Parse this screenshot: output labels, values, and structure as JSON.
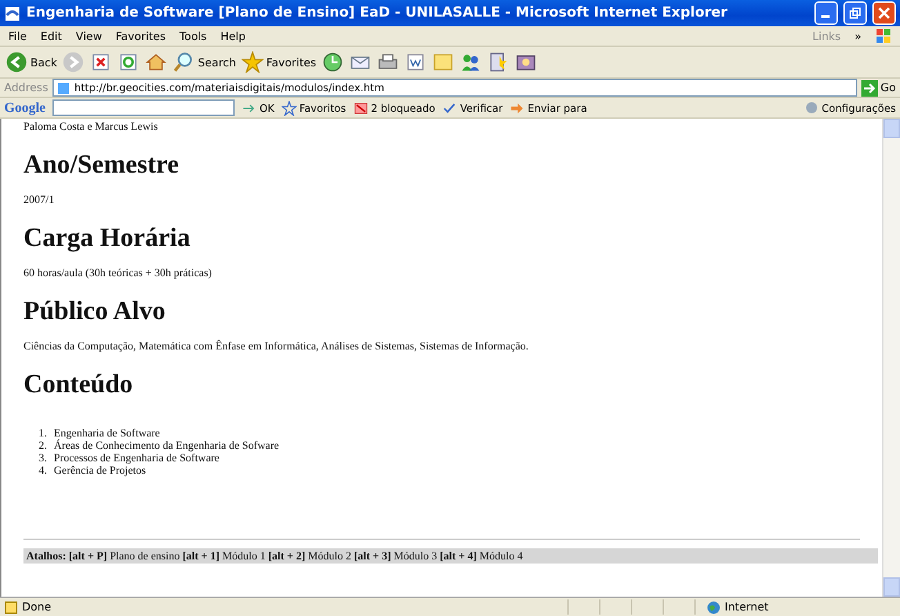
{
  "window": {
    "title": "Engenharia de Software [Plano de Ensino] EaD - UNILASALLE - Microsoft Internet Explorer"
  },
  "menu": [
    "File",
    "Edit",
    "View",
    "Favorites",
    "Tools",
    "Help"
  ],
  "links_label": "Links",
  "links_chevron": "»",
  "toolbar": [
    {
      "kind": "back",
      "label": "Back"
    },
    {
      "kind": "forward"
    },
    {
      "kind": "stop"
    },
    {
      "kind": "refresh"
    },
    {
      "kind": "home"
    },
    {
      "kind": "search",
      "label": "Search"
    },
    {
      "kind": "favorites",
      "label": "Favorites"
    },
    {
      "kind": "history"
    },
    {
      "kind": "mail"
    },
    {
      "kind": "print"
    },
    {
      "kind": "word"
    },
    {
      "kind": "note"
    },
    {
      "kind": "messenger"
    },
    {
      "kind": "research"
    },
    {
      "kind": "people"
    }
  ],
  "address": {
    "label": "Address",
    "value": "http://br.geocities.com/materiaisdigitais/modulos/index.htm",
    "go": "Go"
  },
  "google_bar": {
    "logo": "Google",
    "items": [
      {
        "kind": "ok",
        "label": "OK"
      },
      {
        "kind": "favorites",
        "label": "Favoritos"
      },
      {
        "kind": "blocked",
        "label": "2 bloqueado"
      },
      {
        "kind": "check",
        "label": "Verificar"
      },
      {
        "kind": "send",
        "label": "Enviar para"
      }
    ],
    "settings": "Configurações"
  },
  "content": {
    "authors": "Paloma Costa e Marcus Lewis",
    "sections": [
      {
        "heading": "Ano/Semestre",
        "text": "2007/1"
      },
      {
        "heading": "Carga Horária",
        "text": "60 horas/aula (30h teóricas + 30h práticas)"
      },
      {
        "heading": "Público Alvo",
        "text": "Ciências da Computação, Matemática com Ênfase em Informática, Análises de Sistemas, Sistemas de Informação."
      }
    ],
    "list_heading": "Conteúdo",
    "list": [
      {
        "number": "1.",
        "text": "Engenharia de Software"
      },
      {
        "number": "2.",
        "text": "Áreas de Conhecimento da Engenharia de Sofware"
      },
      {
        "number": "3.",
        "text": "Processos de Engenharia de Software"
      },
      {
        "number": "4.",
        "text": "Gerência de Projetos"
      }
    ],
    "shortcuts": "**Atalhos: [alt + P]** Plano de ensino **[alt + 1]** Módulo 1 **[alt + 2]** Módulo 2 **[alt + 3]** Módulo 3 **[alt + 4]** Módulo 4"
  },
  "status_bar": {
    "text": "Done",
    "zone": "Internet"
  }
}
